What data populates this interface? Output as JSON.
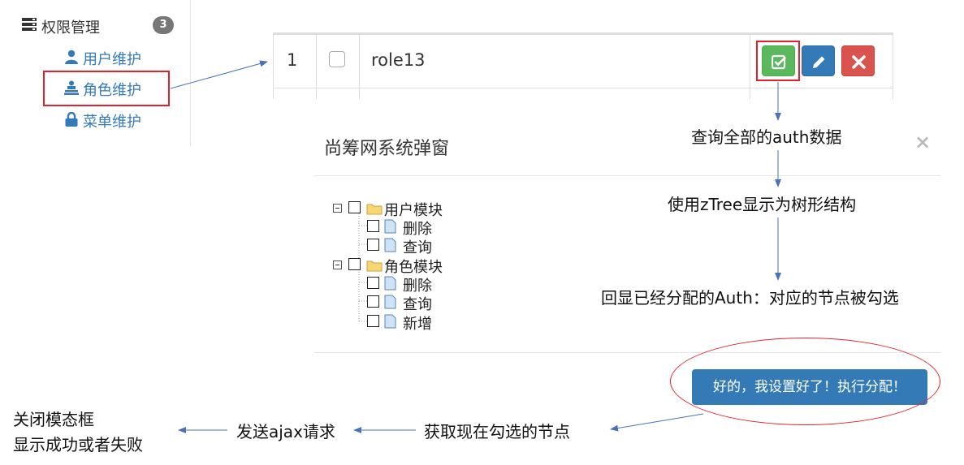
{
  "sidebar": {
    "header": {
      "icon": "server-icon",
      "label": "权限管理",
      "badge": "3"
    },
    "items": [
      {
        "icon": "user-icon",
        "label": "用户维护"
      },
      {
        "icon": "role-icon",
        "label": "角色维护"
      },
      {
        "icon": "lock-icon",
        "label": "菜单维护"
      }
    ]
  },
  "table_row": {
    "number": "1",
    "role_name": "role13",
    "actions": [
      {
        "icon": "check-square-icon",
        "color": "#5cb85c"
      },
      {
        "icon": "pencil-icon",
        "color": "#337ab7"
      },
      {
        "icon": "remove-icon",
        "color": "#d9534f"
      }
    ]
  },
  "modal": {
    "title": "尚筹网系统弹窗",
    "close": "×",
    "tree": [
      {
        "label": "用户模块",
        "children": [
          "删除",
          "查询"
        ]
      },
      {
        "label": "角色模块",
        "children": [
          "删除",
          "查询",
          "新增"
        ]
      }
    ],
    "submit_label": "好的，我设置好了！执行分配！"
  },
  "annotations": {
    "step1": "查询全部的auth数据",
    "step2": "使用zTree显示为树形结构",
    "step3": "回显已经分配的Auth：对应的节点被勾选",
    "get_checked": "获取现在勾选的节点",
    "send_ajax": "发送ajax请求",
    "close_line1": "关闭模态框",
    "close_line2": "显示成功或者失败"
  },
  "colors": {
    "accent": "#337ab7",
    "highlight": "#e3202b",
    "success": "#5cb85c",
    "danger": "#d9534f",
    "folder": "#f7d774",
    "file": "#cfe3f6"
  }
}
